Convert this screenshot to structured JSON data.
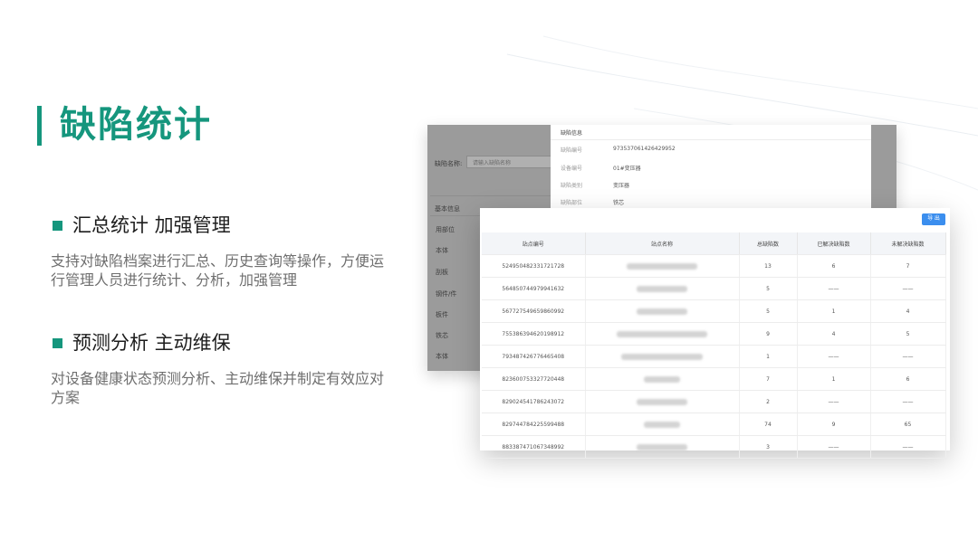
{
  "slide": {
    "title": "缺陷统计",
    "sections": [
      {
        "heading": "汇总统计  加强管理",
        "description": "支持对缺陷档案进行汇总、历史查询等操作，方便运行管理人员进行统计、分析，加强管理"
      },
      {
        "heading": "预测分析  主动维保",
        "description": "对设备健康状态预测分析、主动维保并制定有效应对方案"
      }
    ]
  },
  "back_window": {
    "search_label": "缺陷名称:",
    "search_placeholder": "请输入缺陷名称",
    "section_title": "基本信息",
    "side_items": [
      "用部位",
      "本体",
      "刮板",
      "钢件/件",
      "板件",
      "铁芯",
      "本体"
    ],
    "dialog": {
      "heading": "缺陷信息",
      "rows": [
        {
          "label": "缺陷编号",
          "value": "973537061426429952"
        },
        {
          "label": "设备编号",
          "value": "01#变压器"
        },
        {
          "label": "缺陷类别",
          "value": "变压器"
        },
        {
          "label": "缺陷部位",
          "value": "铁芯"
        }
      ]
    }
  },
  "front_window": {
    "export_label": "导 出",
    "columns": [
      "站点编号",
      "站点名称",
      "总缺陷数",
      "已解决缺陷数",
      "未解决缺陷数"
    ],
    "rows": [
      {
        "id": "524950482331721728",
        "total": "13",
        "solved": "6",
        "unsolved": "7"
      },
      {
        "id": "564850744979941632",
        "total": "5",
        "solved": "——",
        "unsolved": "——"
      },
      {
        "id": "567727549659860992",
        "total": "5",
        "solved": "1",
        "unsolved": "4"
      },
      {
        "id": "755386394620198912",
        "total": "9",
        "solved": "4",
        "unsolved": "5"
      },
      {
        "id": "793487426776465408",
        "total": "1",
        "solved": "——",
        "unsolved": "——"
      },
      {
        "id": "823600753327720448",
        "total": "7",
        "solved": "1",
        "unsolved": "6"
      },
      {
        "id": "829024541786243072",
        "total": "2",
        "solved": "——",
        "unsolved": "——"
      },
      {
        "id": "829744784225599488",
        "total": "74",
        "solved": "9",
        "unsolved": "65"
      },
      {
        "id": "883387471067348992",
        "total": "3",
        "solved": "——",
        "unsolved": "——"
      }
    ]
  }
}
